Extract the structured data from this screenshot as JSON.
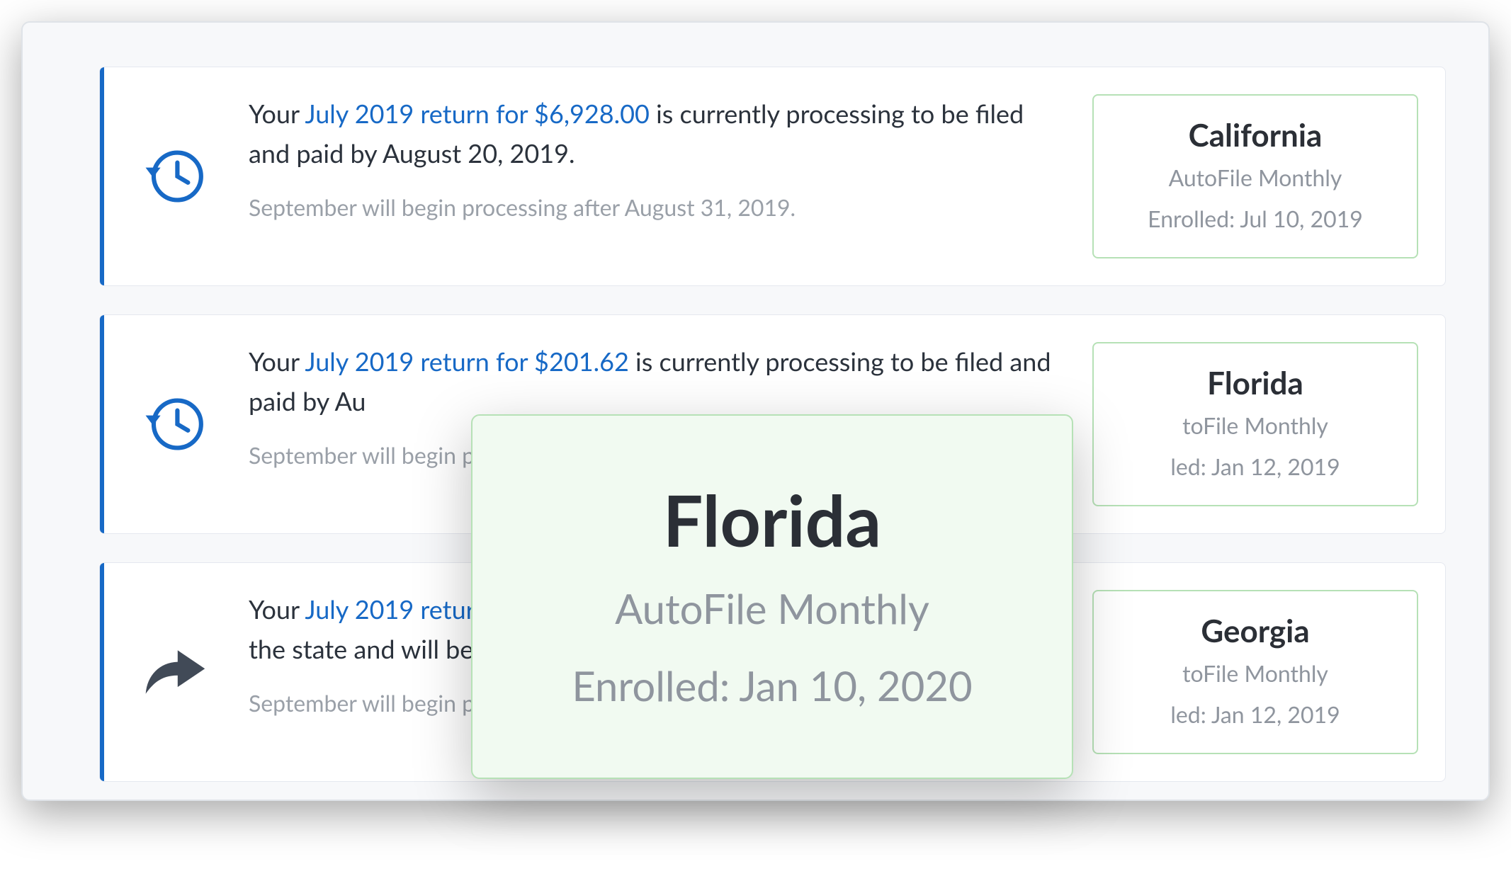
{
  "returns": [
    {
      "msg_prefix": "Your ",
      "msg_link": "July 2019 return for $6,928.00",
      "msg_suffix": " is currently processing to be filed and paid by August 20, 2019.",
      "note": "September will begin processing after August 31, 2019.",
      "state_name": "California",
      "state_plan": "AutoFile Monthly",
      "state_enrolled": "Enrolled: Jul 10, 2019",
      "icon": "history"
    },
    {
      "msg_prefix": "Your ",
      "msg_link": "July 2019 return for $201.62",
      "msg_suffix": " is currently processing to be filed and paid by Au",
      "note": "September will begin pro",
      "state_name": "Florida",
      "state_plan": "toFile Monthly",
      "state_enrolled": "led: Jan 12, 2019",
      "icon": "history"
    },
    {
      "msg_prefix": "Your ",
      "msg_link": "July 2019 return",
      "msg_suffix": " the state and will be c",
      "note": "September will begin pro",
      "state_name": "Georgia",
      "state_plan": "toFile Monthly",
      "state_enrolled": "led: Jan 12, 2019",
      "icon": "share"
    }
  ],
  "popup": {
    "name": "Florida",
    "plan": "AutoFile Monthly",
    "enrolled": "Enrolled: Jan 10, 2020"
  }
}
